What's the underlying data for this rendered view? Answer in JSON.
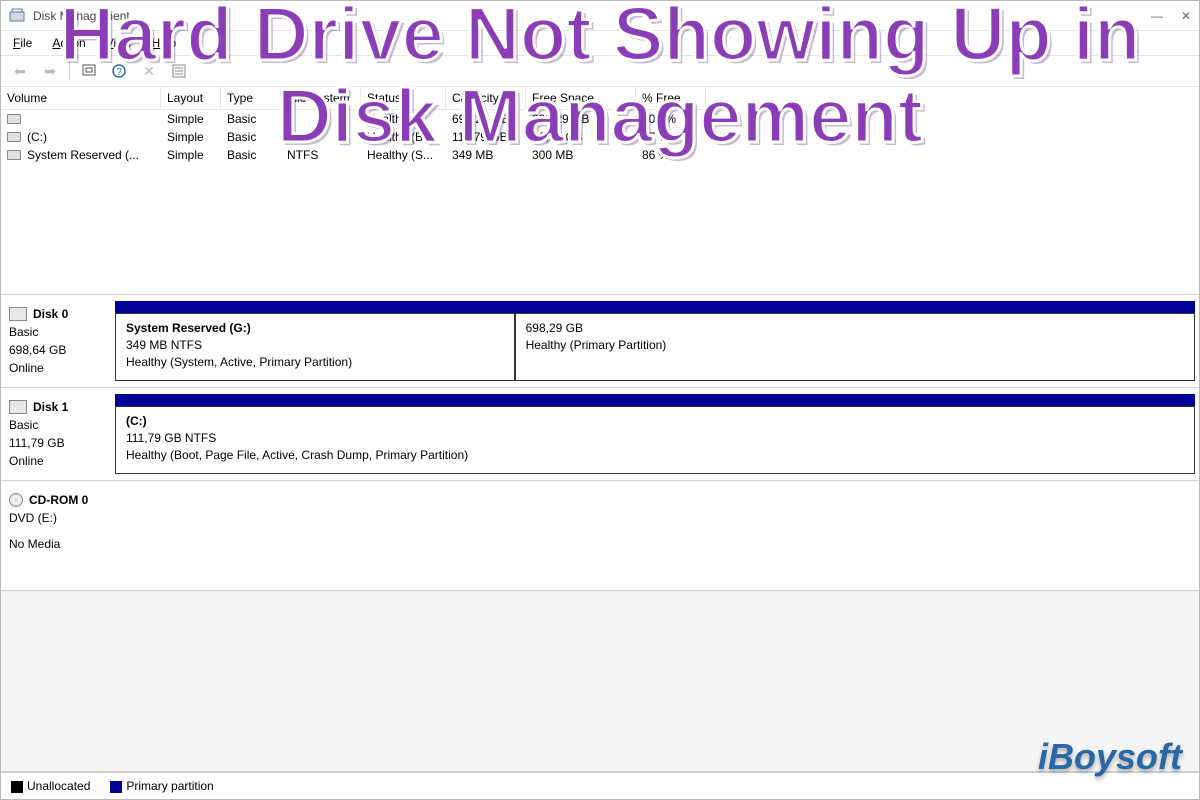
{
  "overlay": {
    "headline": "Hard Drive Not Showing Up in Disk Management",
    "brand": "iBoysoft"
  },
  "window": {
    "title": "Disk Management",
    "controls": {
      "minimize": "—",
      "close": "✕"
    }
  },
  "menu": {
    "file": "File",
    "action": "Action",
    "view": "View",
    "help": "Help"
  },
  "volumes": {
    "headers": {
      "volume": "Volume",
      "layout": "Layout",
      "type": "Type",
      "fs": "File System",
      "status": "Status",
      "capacity": "Capacity",
      "free": "Free Space",
      "pctfree": "% Free"
    },
    "rows": [
      {
        "vol": "",
        "layout": "Simple",
        "type": "Basic",
        "fs": "",
        "status": "Healthy (...",
        "capacity": "698,29 GB",
        "free": "698,29 GB",
        "pctfree": "100 %"
      },
      {
        "vol": "(C:)",
        "layout": "Simple",
        "type": "Basic",
        "fs": "NTFS",
        "status": "Healthy (B...",
        "capacity": "111,79 GB",
        "free": "18,93 GB",
        "pctfree": "17 %"
      },
      {
        "vol": "System Reserved (...",
        "layout": "Simple",
        "type": "Basic",
        "fs": "NTFS",
        "status": "Healthy (S...",
        "capacity": "349 MB",
        "free": "300 MB",
        "pctfree": "86 %"
      }
    ]
  },
  "disks": [
    {
      "name": "Disk 0",
      "type": "Basic",
      "size": "698,64 GB",
      "state": "Online",
      "parts": [
        {
          "name": "System Reserved  (G:)",
          "info": "349 MB NTFS",
          "status": "Healthy (System, Active, Primary Partition)",
          "widthPct": 37
        },
        {
          "name": "",
          "info": "698,29 GB",
          "status": "Healthy (Primary Partition)",
          "widthPct": 63
        }
      ]
    },
    {
      "name": "Disk 1",
      "type": "Basic",
      "size": "111,79 GB",
      "state": "Online",
      "parts": [
        {
          "name": "(C:)",
          "info": "111,79 GB NTFS",
          "status": "Healthy (Boot, Page File, Active, Crash Dump, Primary Partition)",
          "widthPct": 100
        }
      ]
    }
  ],
  "cdrom": {
    "name": "CD-ROM 0",
    "drive": "DVD (E:)",
    "state": "No Media"
  },
  "legend": {
    "unalloc": "Unallocated",
    "primary": "Primary partition"
  }
}
